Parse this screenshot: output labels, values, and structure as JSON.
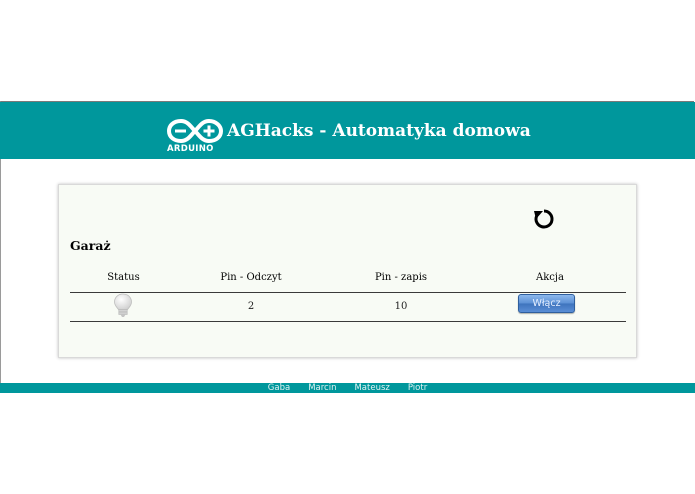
{
  "header": {
    "logo_text": "ARDUINO",
    "title": "AGHacks - Automatyka domowa",
    "color": "#00979c"
  },
  "panel": {
    "refresh_icon": "refresh-icon",
    "section_title": "Garaż",
    "columns": [
      "Status",
      "Pin - Odczyt",
      "Pin - zapis",
      "Akcja"
    ],
    "rows": [
      {
        "status_icon": "lightbulb-off-icon",
        "pin_read": "2",
        "pin_write": "10",
        "action_label": "Włącz"
      }
    ]
  },
  "footer": {
    "links": [
      "Gaba",
      "Marcin",
      "Mateusz",
      "Piotr"
    ]
  }
}
